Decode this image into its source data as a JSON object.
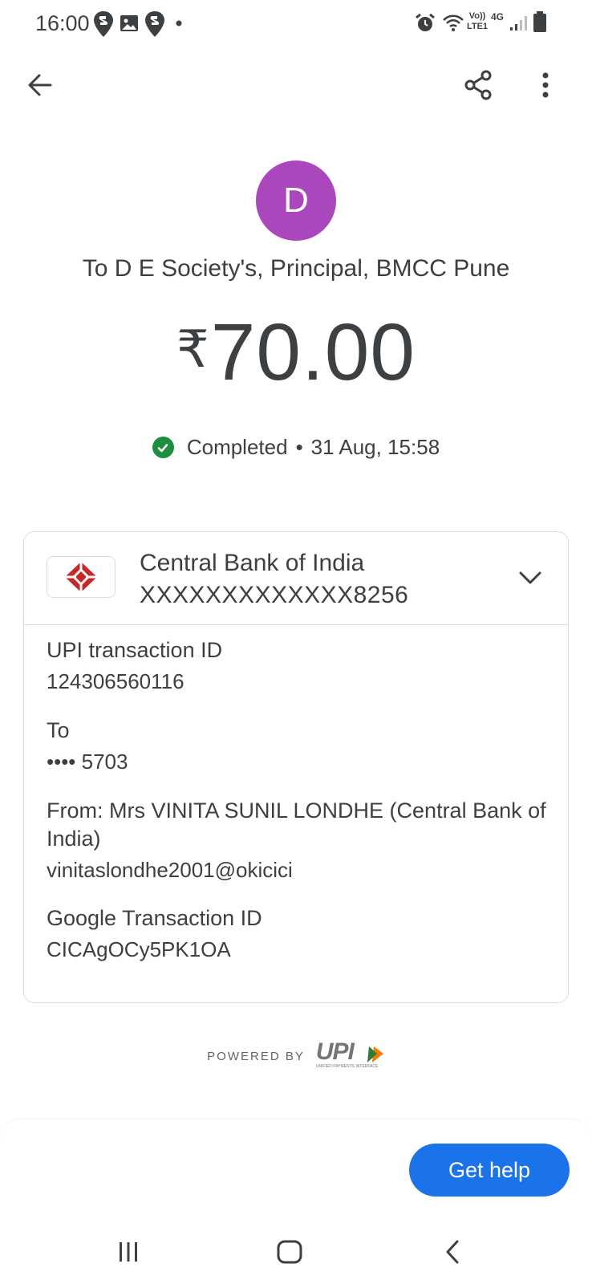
{
  "status_bar": {
    "time": "16:00",
    "network_top": "Vo))",
    "network_bottom": "LTE1",
    "network_type": "4G",
    "icons": [
      "swiggy-notification-icon",
      "gallery-icon",
      "swiggy-notification-icon",
      "notification-dot-icon",
      "alarm-icon",
      "wifi-icon",
      "volte-icon",
      "signal-icon",
      "battery-icon"
    ]
  },
  "app_bar": {
    "back_icon": "back-arrow-icon",
    "share_icon": "share-icon",
    "more_icon": "more-vert-icon"
  },
  "payment": {
    "avatar_letter": "D",
    "avatar_color": "#ab47bc",
    "payee": "To D E Society's, Principal, BMCC Pune",
    "currency": "₹",
    "amount": "70.00",
    "status": "Completed",
    "separator": "•",
    "datetime": "31 Aug, 15:58",
    "status_color": "#1e8e3e"
  },
  "bank": {
    "name": "Central Bank of India",
    "account": "XXXXXXXXXXXXX8256",
    "logo_color": "#d32f2f"
  },
  "details": {
    "upi_label": "UPI transaction ID",
    "upi_value": "124306560116",
    "to_label": "To",
    "to_value": "•••• 5703",
    "from_label": "From: Mrs VINITA SUNIL LONDHE (Central Bank of India)",
    "from_value": "vinitaslondhe2001@okicici",
    "google_label": "Google Transaction ID",
    "google_value": "CICAgOCy5PK1OA"
  },
  "footer": {
    "powered_by": "POWERED BY",
    "upi_logo_text": "UPI",
    "upi_logo_sub": "UNIFIED PAYMENTS INTERFACE",
    "help_label": "Get help",
    "accent": "#1a73e8"
  },
  "nav": {
    "recents_icon": "recents-icon",
    "home_icon": "home-icon",
    "back_icon": "nav-back-icon"
  }
}
